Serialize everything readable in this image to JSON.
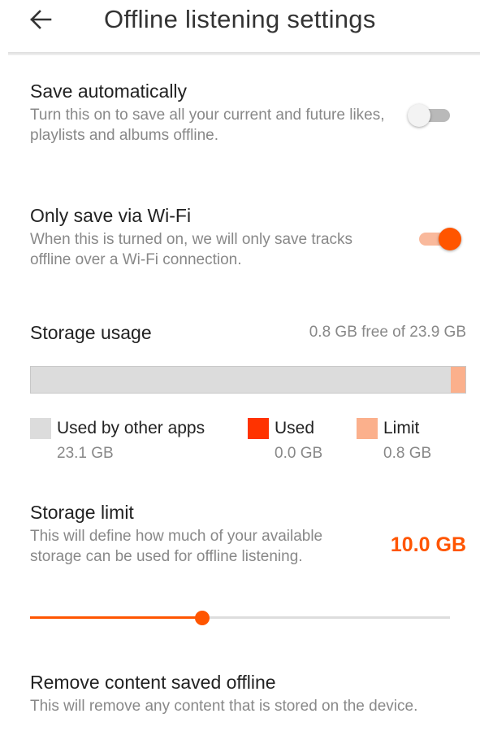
{
  "header": {
    "title": "Offline listening settings",
    "back_icon": "arrow-left-icon"
  },
  "save_automatically": {
    "title": "Save automatically",
    "description": "Turn this on to save all your current and future likes, playlists and albums offline.",
    "enabled": false
  },
  "wifi_only": {
    "title": "Only save via Wi-Fi",
    "description": "When this is turned on, we will only save tracks offline over a Wi-Fi connection.",
    "enabled": true
  },
  "storage_usage": {
    "title": "Storage usage",
    "free_text": "0.8 GB free of 23.9 GB",
    "total_gb": 23.9,
    "bar": {
      "other_apps_gb": 23.1,
      "used_gb": 0.0,
      "limit_gb": 0.8
    },
    "legend": [
      {
        "label": "Used by other apps",
        "value": "23.1 GB",
        "color": "#dcdcdc"
      },
      {
        "label": "Used",
        "value": "0.0 GB",
        "color": "#ff3300"
      },
      {
        "label": "Limit",
        "value": "0.8 GB",
        "color": "#fbb08c"
      }
    ]
  },
  "storage_limit": {
    "title": "Storage limit",
    "description": "This will define how much of your available storage can be used for offline listening.",
    "value_text": "10.0 GB",
    "slider_fraction": 0.41
  },
  "remove_content": {
    "title": "Remove content saved offline",
    "description": "This will remove any content that is stored on the device."
  },
  "colors": {
    "accent": "#ff5500",
    "toggle_track_on": "#f9b99c",
    "toggle_track_off": "#b9b9b9",
    "secondary_text": "#888888"
  }
}
